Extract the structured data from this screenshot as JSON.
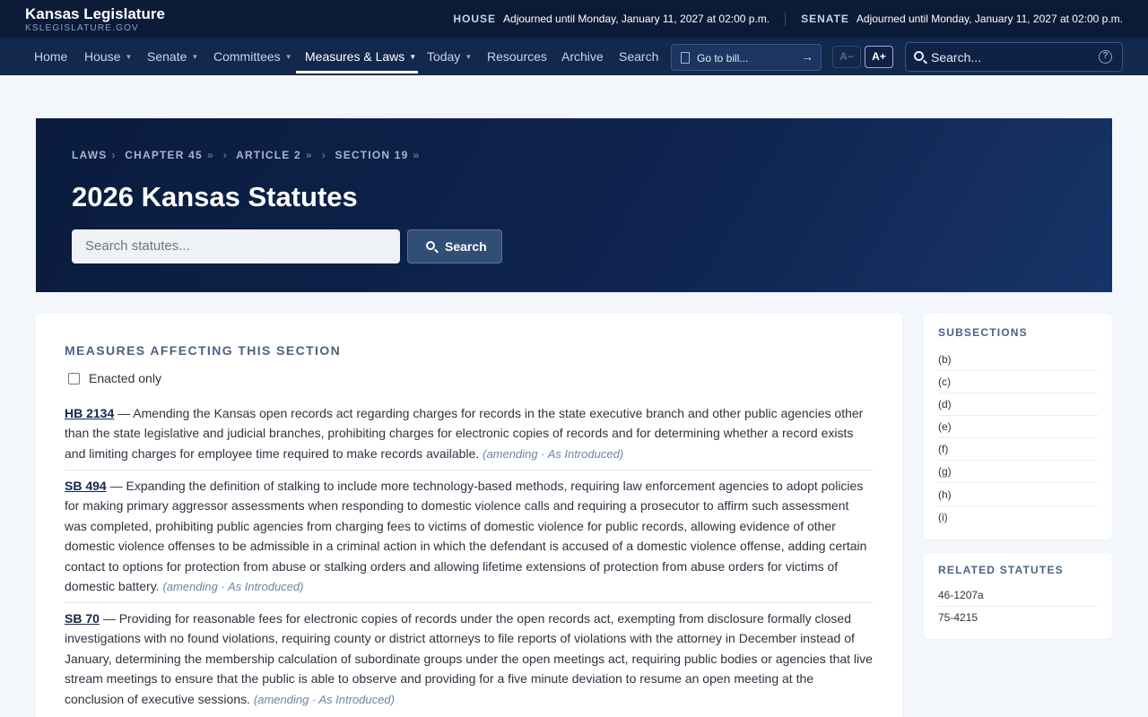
{
  "header": {
    "brand_title": "Kansas Legislature",
    "brand_sub": "KSLEGISLATURE.GOV",
    "house_label": "HOUSE",
    "house_status": "Adjourned until Monday, January 11, 2027 at 02:00 p.m.",
    "senate_label": "SENATE",
    "senate_status": "Adjourned until Monday, January 11, 2027 at 02:00 p.m."
  },
  "nav": {
    "items": [
      {
        "label": "Home",
        "dropdown": false
      },
      {
        "label": "House",
        "dropdown": true
      },
      {
        "label": "Senate",
        "dropdown": true
      },
      {
        "label": "Committees",
        "dropdown": true
      },
      {
        "label": "Measures & Laws",
        "dropdown": true,
        "active": true
      },
      {
        "label": "Today",
        "dropdown": true
      },
      {
        "label": "Resources",
        "dropdown": false
      },
      {
        "label": "Archive",
        "dropdown": false
      },
      {
        "label": "Search",
        "dropdown": false
      }
    ],
    "goto_placeholder": "Go to bill...",
    "font_decrease": "A−",
    "font_increase": "A+",
    "search_placeholder": "Search...",
    "help_glyph": "?"
  },
  "hero": {
    "breadcrumbs": [
      "LAWS",
      "CHAPTER 45",
      "ARTICLE 2",
      "SECTION 19"
    ],
    "title": "2026 Kansas Statutes",
    "search_placeholder": "Search statutes...",
    "search_button": "Search"
  },
  "main": {
    "heading": "MEASURES AFFECTING THIS SECTION",
    "enacted_only_label": "Enacted only",
    "enacted_only_checked": false,
    "measures": [
      {
        "bill": "HB 2134",
        "description": "Amending the Kansas open records act regarding charges for records in the state executive branch and other public agencies other than the state legislative and judicial branches, prohibiting charges for electronic copies of records and for determining whether a record exists and limiting charges for employee time required to make records available.",
        "meta": "(amending · As Introduced)"
      },
      {
        "bill": "SB 494",
        "description": "Expanding the definition of stalking to include more technology-based methods, requiring law enforcement agencies to adopt policies for making primary aggressor assessments when responding to domestic violence calls and requiring a prosecutor to affirm such assessment was completed, prohibiting public agencies from charging fees to victims of domestic violence for public records, allowing evidence of other domestic violence offenses to be admissible in a criminal action in which the defendant is accused of a domestic violence offense, adding certain contact to options for protection from abuse or stalking orders and allowing lifetime extensions of protection from abuse orders for victims of domestic battery.",
        "meta": "(amending · As Introduced)"
      },
      {
        "bill": "SB 70",
        "description": "Providing for reasonable fees for electronic copies of records under the open records act, exempting from disclosure formally closed investigations with no found violations, requiring county or district attorneys to file reports of violations with the attorney in December instead of January, determining the membership calculation of subordinate groups under the open meetings act, requiring public bodies or agencies that live stream meetings to ensure that the public is able to observe and providing for a five minute deviation to resume an open meeting at the conclusion of executive sessions.",
        "meta": "(amending · As Introduced)"
      }
    ]
  },
  "sidebar": {
    "subsections_heading": "SUBSECTIONS",
    "subsections": [
      "(b)",
      "(c)",
      "(d)",
      "(e)",
      "(f)",
      "(g)",
      "(h)",
      "(i)"
    ],
    "related_heading": "RELATED STATUTES",
    "related": [
      "46-1207a",
      "75-4215"
    ]
  }
}
